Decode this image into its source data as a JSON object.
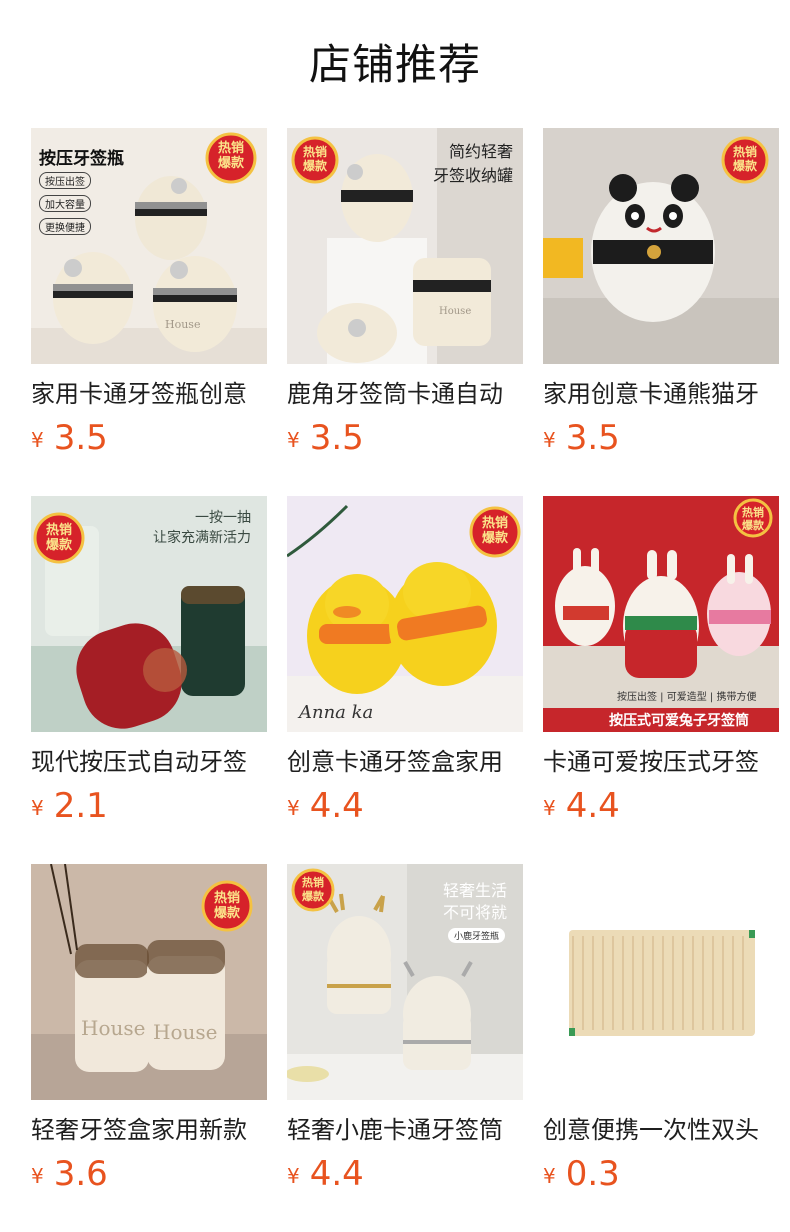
{
  "header": {
    "title": "店铺推荐"
  },
  "products": [
    {
      "name": "家用卡通牙签瓶创意",
      "currency": "¥",
      "price": "3.5",
      "image": {
        "bg": "#f3efe9",
        "overlay_lines": [
          "按压牙签瓶"
        ],
        "tags": [
          "按压出签",
          "加大容量",
          "更换便捷"
        ],
        "badge": [
          "热销",
          "爆款"
        ],
        "brand": "House"
      }
    },
    {
      "name": "鹿角牙签筒卡通自动",
      "currency": "¥",
      "price": "3.5",
      "image": {
        "bg": "#e9e6e2",
        "overlay_lines": [
          "简约轻奢",
          "牙签收纳罐"
        ],
        "badge": [
          "热销",
          "爆款"
        ],
        "brand": "House"
      }
    },
    {
      "name": "家用创意卡通熊猫牙",
      "currency": "¥",
      "price": "3.5",
      "image": {
        "bg": "#cfcac5",
        "badge": [
          "热销",
          "爆款"
        ]
      }
    },
    {
      "name": "现代按压式自动牙签",
      "currency": "¥",
      "price": "2.1",
      "image": {
        "bg": "#dfe7e1",
        "overlay_lines": [
          "一按一抽",
          "让家充满新活力"
        ],
        "badge": [
          "热销",
          "爆款"
        ]
      }
    },
    {
      "name": "创意卡通牙签盒家用",
      "currency": "¥",
      "price": "4.4",
      "image": {
        "bg": "#efe9f3",
        "badge": [
          "热销",
          "爆款"
        ],
        "caption": "Anna ka"
      }
    },
    {
      "name": "卡通可爱按压式牙签",
      "currency": "¥",
      "price": "4.4",
      "image": {
        "bg": "#c9252a",
        "badge": [
          "热销",
          "爆款"
        ],
        "tags": [
          "按压出签",
          "可爱造型",
          "携带方便"
        ],
        "banner": "按压式可爱兔子牙签筒"
      }
    },
    {
      "name": "轻奢牙签盒家用新款",
      "currency": "¥",
      "price": "3.6",
      "image": {
        "bg": "#c9b6a6",
        "badge": [
          "热销",
          "爆款"
        ],
        "brand": "House"
      }
    },
    {
      "name": "轻奢小鹿卡通牙签筒",
      "currency": "¥",
      "price": "4.4",
      "image": {
        "bg": "#e7e6e2",
        "overlay_lines": [
          "轻奢生活",
          "不可将就"
        ],
        "tags": [
          "小鹿牙签瓶"
        ],
        "badge": [
          "热销",
          "爆款"
        ]
      }
    },
    {
      "name": "创意便携一次性双头",
      "currency": "¥",
      "price": "0.3",
      "image": {
        "bg": "#ffffff"
      }
    }
  ]
}
